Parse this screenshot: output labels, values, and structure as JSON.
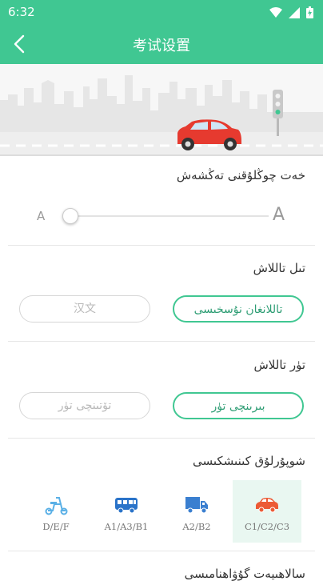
{
  "status_bar": {
    "time": "6:32"
  },
  "header": {
    "title": "考试设置"
  },
  "font_size": {
    "title": "خەت چوڭلۇقنى تەڭشەش",
    "small_label": "A",
    "large_label": "A",
    "slider_fraction": 0.0
  },
  "language": {
    "title": "تىل تاللاش",
    "options": [
      "تاللانغان نۇسخىسى",
      "汉文"
    ],
    "selected": "تاللانغان نۇسخىسى"
  },
  "level": {
    "title": "تۈر تاللاش",
    "options": [
      "بىرىنچى تۈر",
      "تۆتىنچى تۈر"
    ],
    "selected": "بىرىنچى تۈر"
  },
  "license": {
    "title": "شوپۇرلۇق كىنىشكىسى",
    "selected": "C1/C2/C3",
    "items": [
      {
        "label": "D/E/F",
        "icon": "scooter-icon",
        "color": "#5ab0e6"
      },
      {
        "label": "A1/A3/B1",
        "icon": "bus-icon",
        "color": "#2a73c9"
      },
      {
        "label": "A2/B2",
        "icon": "truck-icon",
        "color": "#3a7fd0"
      },
      {
        "label": "C1/C2/C3",
        "icon": "car-icon",
        "color": "#ec5a35"
      }
    ]
  },
  "next_section": {
    "title": "سالاھىيەت گۇۋاھنامىسى"
  },
  "colors": {
    "accent": "#40c792",
    "selected_bg": "#e9f7f1"
  }
}
